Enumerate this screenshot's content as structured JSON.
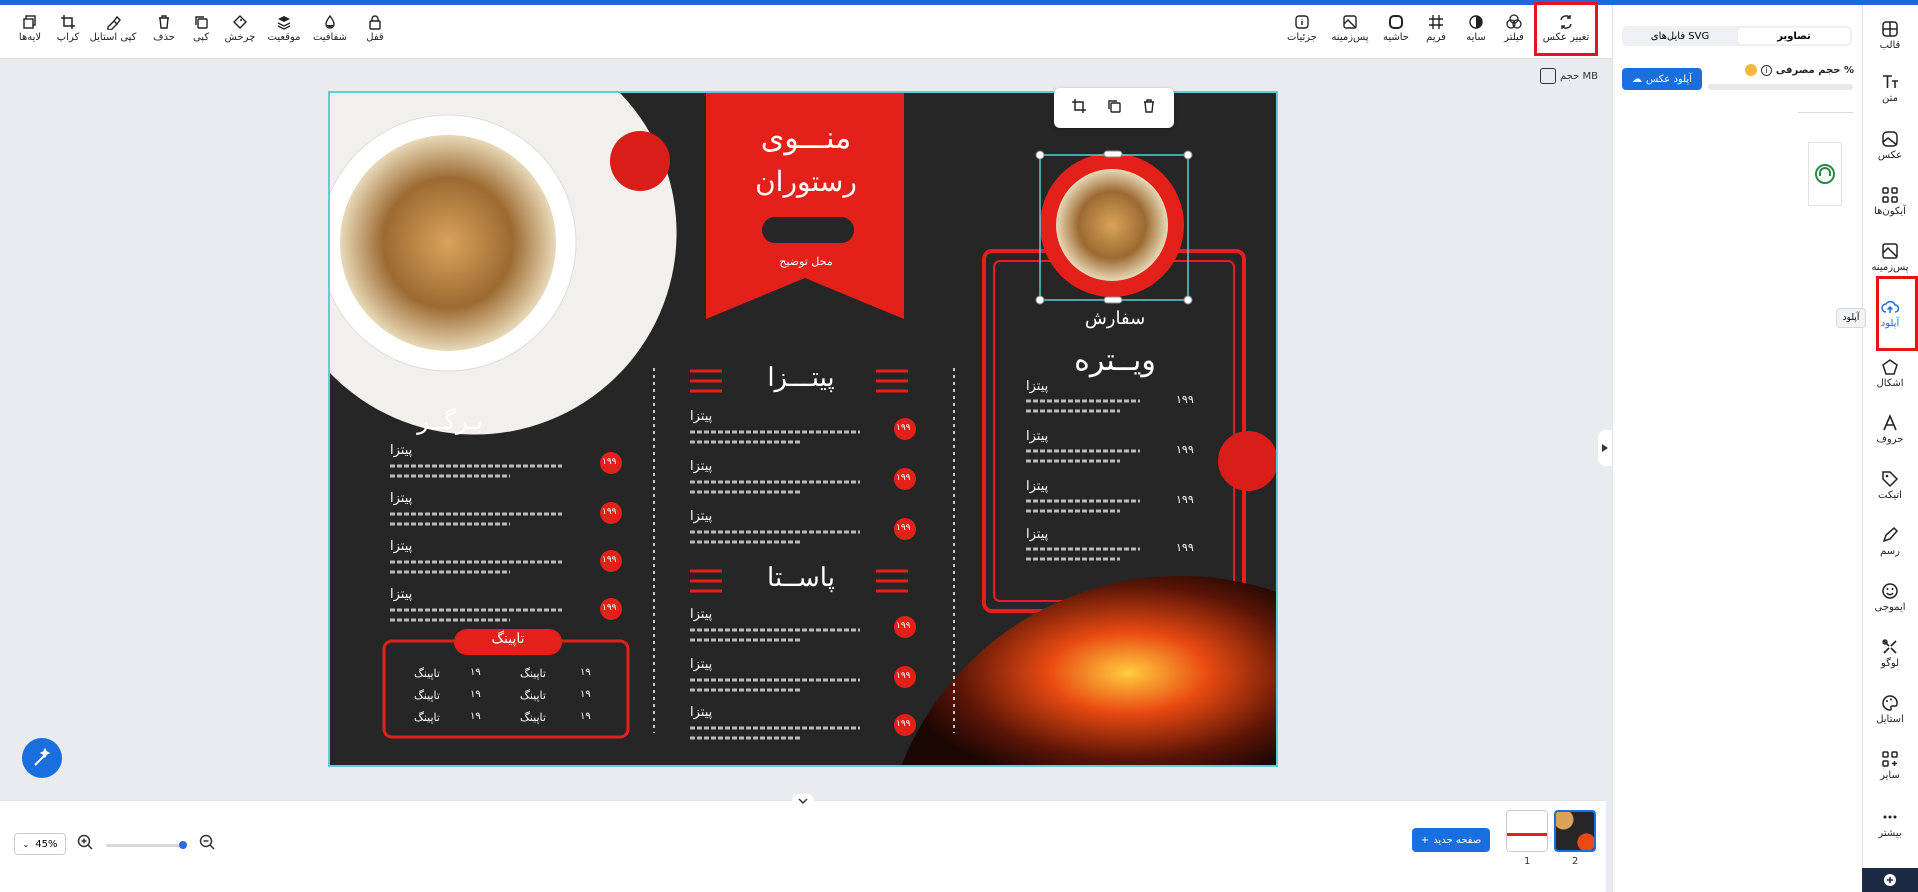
{
  "toolbar": {
    "left_items": [
      {
        "label": "لایه‌ها",
        "icon": "layers-icon"
      },
      {
        "label": "کراپ",
        "icon": "crop-icon"
      },
      {
        "label": "کپی استایل",
        "icon": "copy-style-icon"
      },
      {
        "label": "حذف",
        "icon": "trash-icon"
      },
      {
        "label": "کپی",
        "icon": "copy-icon"
      },
      {
        "label": "چرخش",
        "icon": "rotate-icon"
      },
      {
        "label": "موقعیت",
        "icon": "position-icon"
      },
      {
        "label": "شفافیت",
        "icon": "opacity-icon"
      },
      {
        "label": "قفل",
        "icon": "lock-icon"
      }
    ],
    "right_items": [
      {
        "label": "جزئیات",
        "icon": "info-icon"
      },
      {
        "label": "پس‌زمینه",
        "icon": "background-icon"
      },
      {
        "label": "حاشیه",
        "icon": "border-icon"
      },
      {
        "label": "فریم",
        "icon": "frame-icon"
      },
      {
        "label": "سایه",
        "icon": "shadow-icon"
      },
      {
        "label": "فیلتر",
        "icon": "filter-icon"
      },
      {
        "label": "تغییر عکس",
        "icon": "replace-image-icon"
      }
    ]
  },
  "size_label": "حجم MB",
  "zoom": "45%",
  "new_page_label": "صفحه جدید",
  "pages": [
    "1",
    "2"
  ],
  "panel": {
    "tabs": [
      "تصاویر",
      "فایل‌های SVG"
    ],
    "usage_label": "حجم مصرفی %",
    "upload_button": "آپلود عکس"
  },
  "sidebar": [
    {
      "label": "قالب",
      "icon": "template-icon"
    },
    {
      "label": "متن",
      "icon": "text-icon"
    },
    {
      "label": "عکس",
      "icon": "photo-icon"
    },
    {
      "label": "آیکون‌ها",
      "icon": "icons-grid-icon"
    },
    {
      "label": "پس‌زمینه",
      "icon": "background-icon"
    },
    {
      "label": "آپلود",
      "icon": "upload-cloud-icon"
    },
    {
      "label": "اشکال",
      "icon": "shapes-icon"
    },
    {
      "label": "حروف",
      "icon": "font-icon"
    },
    {
      "label": "اتیکت",
      "icon": "tag-icon"
    },
    {
      "label": "رسم",
      "icon": "pen-icon"
    },
    {
      "label": "ایموجی",
      "icon": "emoji-icon"
    },
    {
      "label": "لوگو",
      "icon": "logo-icon"
    },
    {
      "label": "استایل",
      "icon": "palette-icon"
    },
    {
      "label": "سایر",
      "icon": "more-grid-icon"
    },
    {
      "label": "بیشتر",
      "icon": "ellipsis-icon"
    }
  ],
  "tooltip": "آپلود",
  "menu": {
    "title1": "منـــوی",
    "title2": "رستوران",
    "place_text": "محل توضیح",
    "sections": [
      "پیتـــزا",
      "پاســتا",
      "بـرگــر",
      "تاپینگ",
      "ویــتره"
    ],
    "item_name": "پیتزا",
    "item_desc": "توضیحات کوتاه برای هر محصول",
    "price": "۱۹۹",
    "topping": "تاپینگ",
    "topping_price": "۱۹",
    "special": "سفارش"
  }
}
